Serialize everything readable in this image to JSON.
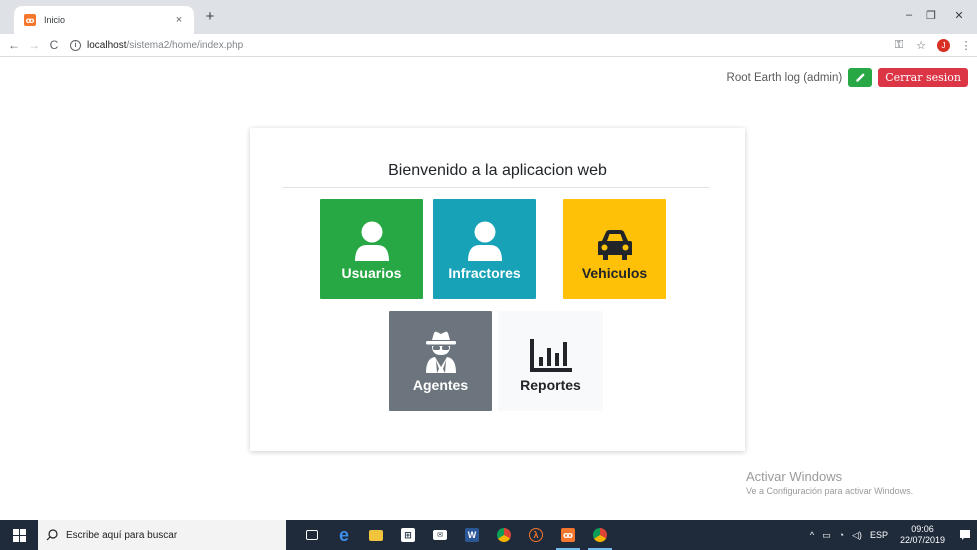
{
  "browser": {
    "tab_title": "Inicio",
    "tab_close": "×",
    "new_tab": "+",
    "url_host": "localhost",
    "url_path": "/sistema2/home/index.php",
    "nav_back": "←",
    "nav_forward": "→",
    "nav_reload": "C",
    "profile_initial": "J",
    "win_min": "–",
    "win_restore": "❐",
    "win_close": "✕",
    "key_icon": "⚿",
    "star_icon": "☆",
    "menu_icon": "⋮"
  },
  "header": {
    "user_label": "Root Earth log (admin)",
    "logout_label": "Cerrar sesion"
  },
  "card": {
    "title": "Bienvenido a la aplicacion web",
    "tiles": [
      {
        "label": "Usuarios",
        "icon": "user-icon",
        "color": "#28a745",
        "text_color": "#ffffff"
      },
      {
        "label": "Infractores",
        "icon": "user-icon",
        "color": "#17a2b8",
        "text_color": "#ffffff"
      },
      {
        "label": "Vehiculos",
        "icon": "car-icon",
        "color": "#ffc107",
        "text_color": "#212529"
      },
      {
        "label": "Agentes",
        "icon": "user-secret-icon",
        "color": "#6c757d",
        "text_color": "#ffffff"
      },
      {
        "label": "Reportes",
        "icon": "chart-bar-icon",
        "color": "#f8f9fa",
        "text_color": "#212529"
      }
    ]
  },
  "watermark": {
    "line1": "Activar Windows",
    "line2": "Ve a Configuración para activar Windows."
  },
  "taskbar": {
    "search_placeholder": "Escribe aquí para buscar",
    "language": "ESP",
    "time": "09:06",
    "date": "22/07/2019"
  }
}
